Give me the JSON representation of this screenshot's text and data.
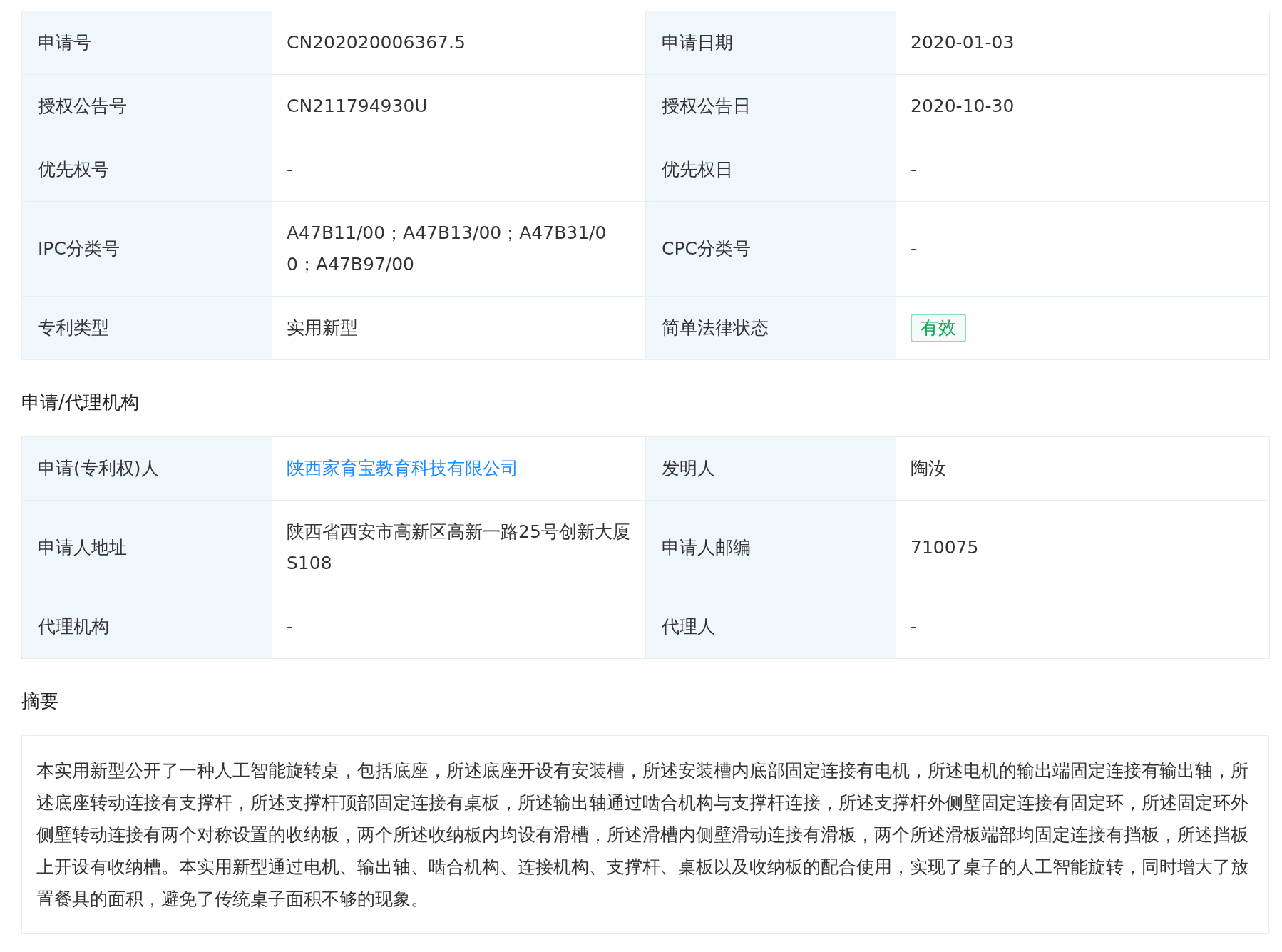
{
  "basic_table": {
    "rows": [
      {
        "cells": [
          {
            "label": "申请号",
            "value": "CN202020006367.5",
            "kind": "text"
          },
          {
            "label": "申请日期",
            "value": "2020-01-03",
            "kind": "text"
          }
        ]
      },
      {
        "cells": [
          {
            "label": "授权公告号",
            "value": "CN211794930U",
            "kind": "text"
          },
          {
            "label": "授权公告日",
            "value": "2020-10-30",
            "kind": "text"
          }
        ]
      },
      {
        "cells": [
          {
            "label": "优先权号",
            "value": "-",
            "kind": "text"
          },
          {
            "label": "优先权日",
            "value": "-",
            "kind": "text"
          }
        ]
      },
      {
        "cells": [
          {
            "label": "IPC分类号",
            "value": "A47B11/00；A47B13/00；A47B31/00；A47B97/00",
            "kind": "text"
          },
          {
            "label": "CPC分类号",
            "value": "-",
            "kind": "text"
          }
        ]
      },
      {
        "cells": [
          {
            "label": "专利类型",
            "value": "实用新型",
            "kind": "text"
          },
          {
            "label": "简单法律状态",
            "value": "有效",
            "kind": "badge"
          }
        ]
      }
    ]
  },
  "agency_section": {
    "title": "申请/代理机构",
    "rows": [
      {
        "cells": [
          {
            "label": "申请(专利权)人",
            "value": "陕西家育宝教育科技有限公司",
            "kind": "link"
          },
          {
            "label": "发明人",
            "value": "陶汝",
            "kind": "text"
          }
        ]
      },
      {
        "cells": [
          {
            "label": "申请人地址",
            "value": "陕西省西安市高新区高新一路25号创新大厦S108",
            "kind": "text"
          },
          {
            "label": "申请人邮编",
            "value": "710075",
            "kind": "text"
          }
        ]
      },
      {
        "cells": [
          {
            "label": "代理机构",
            "value": "-",
            "kind": "text"
          },
          {
            "label": "代理人",
            "value": "-",
            "kind": "text"
          }
        ]
      }
    ]
  },
  "abstract_section": {
    "title": "摘要",
    "text": "本实用新型公开了一种人工智能旋转桌，包括底座，所述底座开设有安装槽，所述安装槽内底部固定连接有电机，所述电机的输出端固定连接有输出轴，所述底座转动连接有支撑杆，所述支撑杆顶部固定连接有桌板，所述输出轴通过啮合机构与支撑杆连接，所述支撑杆外侧壁固定连接有固定环，所述固定环外侧壁转动连接有两个对称设置的收纳板，两个所述收纳板内均设有滑槽，所述滑槽内侧壁滑动连接有滑板，两个所述滑板端部均固定连接有挡板，所述挡板上开设有收纳槽。本实用新型通过电机、输出轴、啮合机构、连接机构、支撑杆、桌板以及收纳板的配合使用，实现了桌子的人工智能旋转，同时增大了放置餐具的面积，避免了传统桌子面积不够的现象。"
  }
}
